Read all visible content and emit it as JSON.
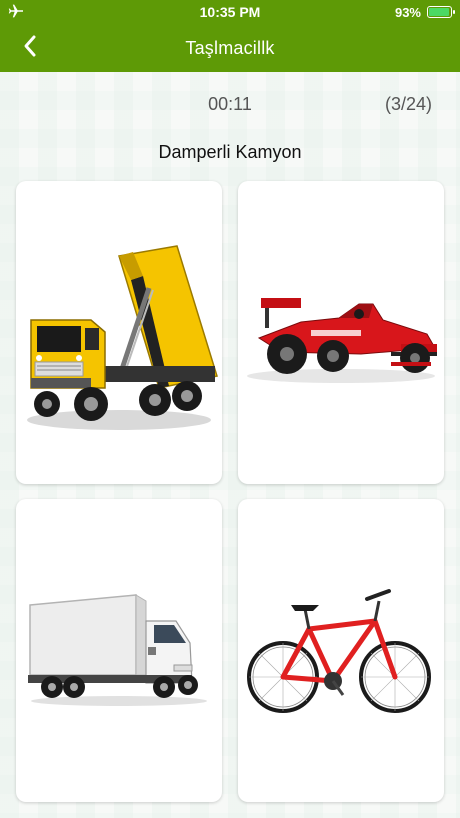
{
  "status_bar": {
    "time": "10:35 PM",
    "battery_text": "93%",
    "battery_level": 0.93,
    "airplane_icon": "airplane-icon"
  },
  "nav": {
    "title": "Taşlmacillk",
    "back_icon": "chevron-left-icon"
  },
  "quiz": {
    "timer": "00:11",
    "progress": "(3/24)",
    "question": "Damperli Kamyon"
  },
  "answers": [
    {
      "image": "dump-truck-image"
    },
    {
      "image": "race-car-image"
    },
    {
      "image": "box-truck-image"
    },
    {
      "image": "bicycle-image"
    }
  ],
  "colors": {
    "primary_green": "#5e9a06",
    "battery_green": "#4cd964",
    "truck_yellow": "#f5c400",
    "car_red": "#d8161b",
    "bike_red": "#e02020"
  }
}
